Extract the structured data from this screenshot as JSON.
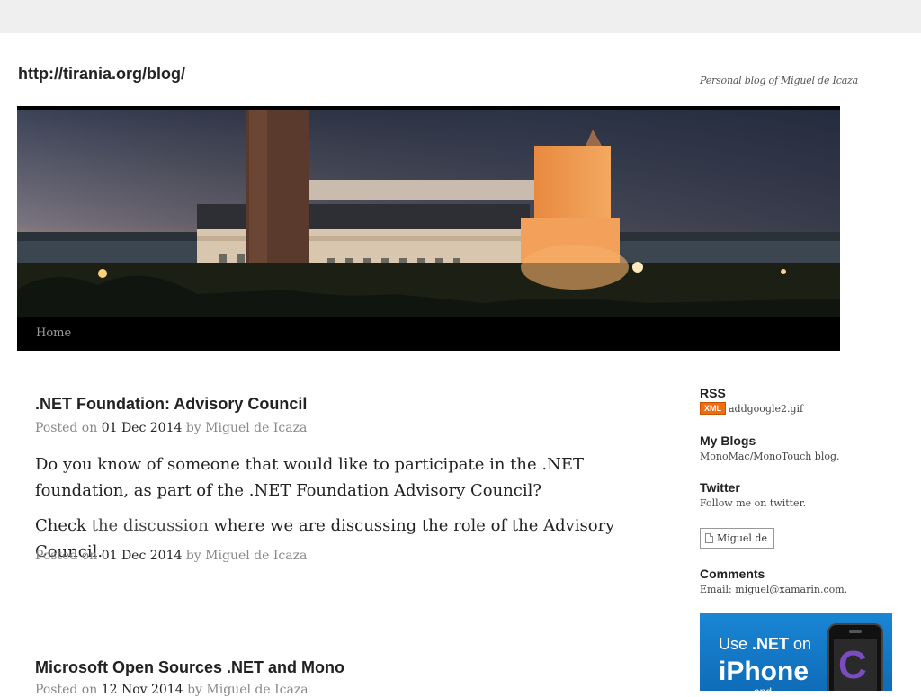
{
  "header": {
    "site_title": "http://tirania.org/blog/",
    "site_description": "Personal blog of Miguel de Icaza",
    "nav_home": "Home"
  },
  "posts": [
    {
      "title": ".NET Foundation: Advisory Council",
      "meta_prefix": "Posted on",
      "date": "01 Dec 2014",
      "meta_by": "by",
      "author": "Miguel de Icaza",
      "p1": "Do you know of someone that would like to participate in the .NET foundation, as part of the .NET Foundation Advisory Council?",
      "p2_pre": "Check ",
      "p2_link": "the discussion",
      "p2_post": " where we are discussing the role of the Advisory Council.",
      "footer_prefix": "Posted on",
      "footer_date": "01 Dec 2014",
      "footer_by": "by",
      "footer_author": "Miguel de Icaza"
    },
    {
      "title": "Microsoft Open Sources .NET and Mono",
      "meta_prefix": "Posted on",
      "date": "12 Nov 2014",
      "meta_by": "by",
      "author": "Miguel de Icaza"
    }
  ],
  "sidebar": {
    "rss": {
      "title": "RSS",
      "badge": "XML",
      "image_alt": "addgoogle2.gif"
    },
    "blogs": {
      "title": "My Blogs",
      "text": "MonoMac/MonoTouch blog."
    },
    "twitter": {
      "title": "Twitter",
      "text": "Follow me on twitter.",
      "image_alt": "Miguel de"
    },
    "comments": {
      "title": "Comments",
      "label": "Email:",
      "email": "miguel@xamarin.com."
    },
    "ad": {
      "line1_pre": "Use ",
      "line1_bold": ".NET",
      "line1_post": " on",
      "line2": "iPhone",
      "line3": "and"
    }
  },
  "colors": {
    "nav_bg": "#000000",
    "rss_badge": "#f26b0e",
    "ad_bg": "#1478c8"
  }
}
